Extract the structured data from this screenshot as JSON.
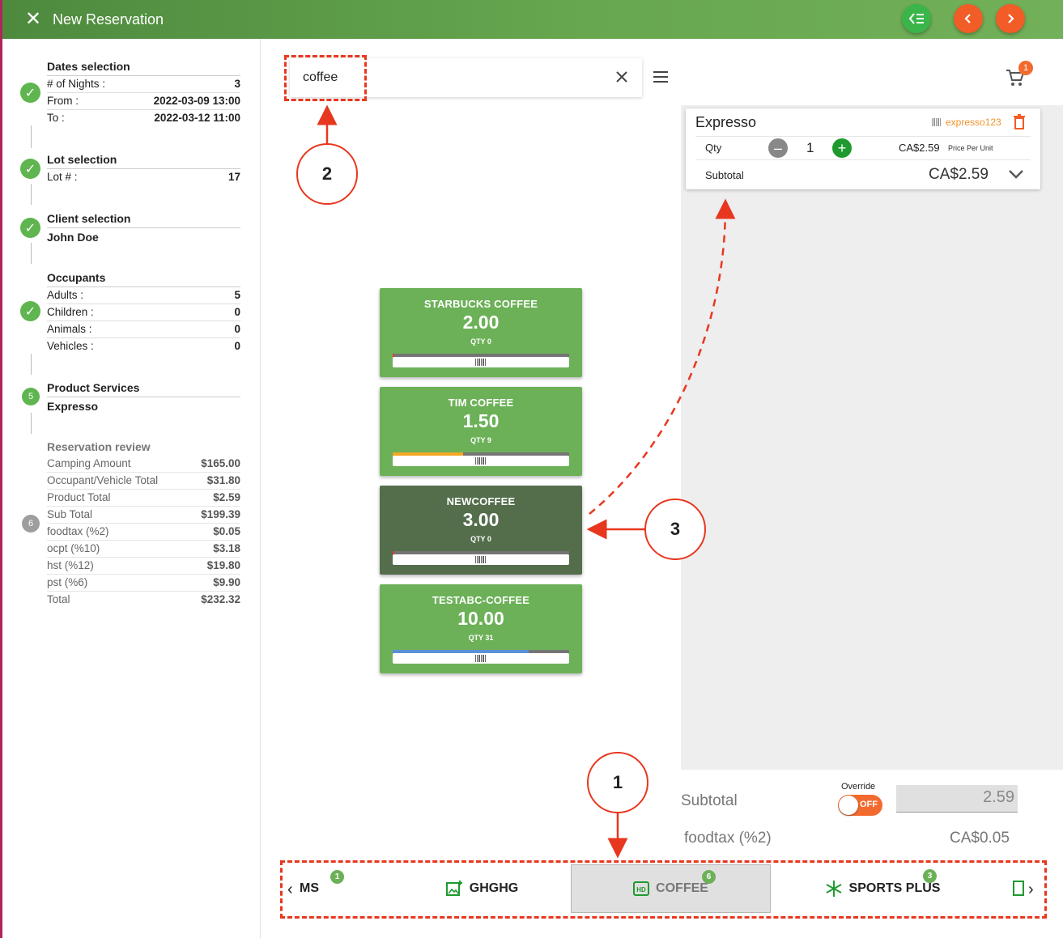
{
  "header": {
    "title": "New Reservation",
    "close_icon": "close-icon",
    "buttons": [
      "checklist-icon",
      "chevron-left-icon",
      "chevron-right-icon"
    ]
  },
  "sidebar": {
    "dates": {
      "title": "Dates selection",
      "nights_label": "# of Nights :",
      "nights": "3",
      "from_label": "From :",
      "from": "2022-03-09 13:00",
      "to_label": "To :",
      "to": "2022-03-12 11:00"
    },
    "lot": {
      "title": "Lot selection",
      "lot_label": "Lot # :",
      "lot": "17"
    },
    "client": {
      "title": "Client selection",
      "name": "John Doe"
    },
    "occupants": {
      "title": "Occupants",
      "adults_label": "Adults :",
      "adults": "5",
      "children_label": "Children :",
      "children": "0",
      "animals_label": "Animals :",
      "animals": "0",
      "vehicles_label": "Vehicles :",
      "vehicles": "0"
    },
    "products": {
      "step": "5",
      "title": "Product Services",
      "item": "Expresso"
    },
    "review": {
      "step": "6",
      "title": "Reservation review",
      "rows": [
        {
          "label": "Camping Amount",
          "value": "$165.00"
        },
        {
          "label": "Occupant/Vehicle Total",
          "value": "$31.80"
        },
        {
          "label": "Product Total",
          "value": "$2.59"
        },
        {
          "label": "Sub Total",
          "value": "$199.39"
        },
        {
          "label": "foodtax (%2)",
          "value": "$0.05"
        },
        {
          "label": "ocpt (%10)",
          "value": "$3.18"
        },
        {
          "label": "hst (%12)",
          "value": "$19.80"
        },
        {
          "label": "pst (%6)",
          "value": "$9.90"
        },
        {
          "label": "Total",
          "value": "$232.32"
        }
      ]
    }
  },
  "search": {
    "value": "coffee",
    "placeholder": ""
  },
  "cart": {
    "badge": "1",
    "item": {
      "name": "Expresso",
      "sku": "expresso123",
      "qty_label": "Qty",
      "qty": "1",
      "price": "CA$2.59",
      "price_note": "Price Per Unit",
      "subtotal_label": "Subtotal",
      "subtotal": "CA$2.59"
    }
  },
  "totals": {
    "subtotal_label": "Subtotal",
    "override_label": "Override",
    "override_state": "OFF",
    "override_value": "2.59",
    "foodtax_label": "foodtax (%2)",
    "foodtax_value": "CA$0.05"
  },
  "products": [
    {
      "name": "STARBUCKS COFFEE",
      "price": "2.00",
      "qty": "QTY 0",
      "stock_fraction": 0.01,
      "bar_color": "#e53935",
      "selected": false
    },
    {
      "name": "TIM COFFEE",
      "price": "1.50",
      "qty": "QTY 9",
      "stock_fraction": 0.4,
      "bar_color": "#f5a623",
      "selected": false
    },
    {
      "name": "NEWCOFFEE",
      "price": "3.00",
      "qty": "QTY 0",
      "stock_fraction": 0.01,
      "bar_color": "#e53935",
      "selected": true
    },
    {
      "name": "TESTABC-COFFEE",
      "price": "10.00",
      "qty": "QTY 31",
      "stock_fraction": 0.77,
      "bar_color": "#5b8fd6",
      "selected": false
    }
  ],
  "tabs": [
    {
      "label": "MS",
      "badge": "1",
      "icon": "",
      "active": false
    },
    {
      "label": "GHGHG",
      "badge": "",
      "icon": "add-photo-icon",
      "active": false
    },
    {
      "label": "COFFEE",
      "badge": "6",
      "icon": "hd-icon",
      "active": true
    },
    {
      "label": "SPORTS PLUS",
      "badge": "3",
      "icon": "snowflake-icon",
      "active": false
    }
  ],
  "annotations": [
    "1",
    "2",
    "3"
  ],
  "colors": {
    "brand_green": "#6cb158",
    "accent_orange": "#f25c26",
    "annotation_red": "#e8371f"
  }
}
